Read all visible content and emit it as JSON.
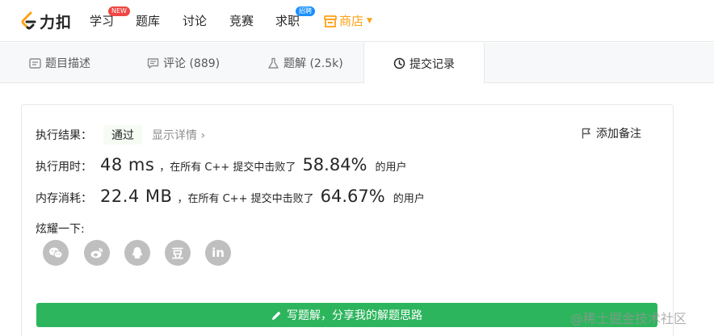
{
  "nav": {
    "logo_text": "力扣",
    "items": [
      {
        "label": "学习",
        "badge": "NEW"
      },
      {
        "label": "题库"
      },
      {
        "label": "讨论"
      },
      {
        "label": "竞赛"
      },
      {
        "label": "求职",
        "badge": "招聘"
      }
    ],
    "store_label": "商店",
    "colors": {
      "store": "#ffa116",
      "badge_new": "#ef4743",
      "badge_hire": "#1a90ff"
    }
  },
  "tabs": [
    {
      "label": "题目描述",
      "icon": "description-icon"
    },
    {
      "label": "评论 (889)",
      "icon": "comment-icon"
    },
    {
      "label": "题解 (2.5k)",
      "icon": "flask-icon"
    },
    {
      "label": "提交记录",
      "icon": "clock-icon",
      "active": true
    }
  ],
  "result": {
    "label": "执行结果：",
    "status": "通过",
    "details_label": "显示详情",
    "add_note_label": "添加备注"
  },
  "runtime": {
    "label": "执行用时：",
    "value": "48 ms",
    "text": "，在所有 C++ 提交中击败了",
    "percent": "58.84%",
    "users": "的用户"
  },
  "memory": {
    "label": "内存消耗：",
    "value": "22.4 MB",
    "text": "，在所有 C++ 提交中击败了",
    "percent": "64.67%",
    "users": "的用户"
  },
  "share": {
    "label": "炫耀一下:",
    "items": [
      {
        "icon": "wechat-icon"
      },
      {
        "icon": "weibo-icon"
      },
      {
        "icon": "qq-icon"
      },
      {
        "icon": "douban-icon",
        "text": "豆"
      },
      {
        "icon": "linkedin-icon",
        "text": "in"
      }
    ]
  },
  "write_solution_label": "写题解，分享我的解题思路",
  "watermark": "@稀土掘金技术社区",
  "colors": {
    "primary_button": "#2db55d",
    "pass_bg": "#f6fbf4",
    "share_icon_bg": "#bfbfbf"
  }
}
